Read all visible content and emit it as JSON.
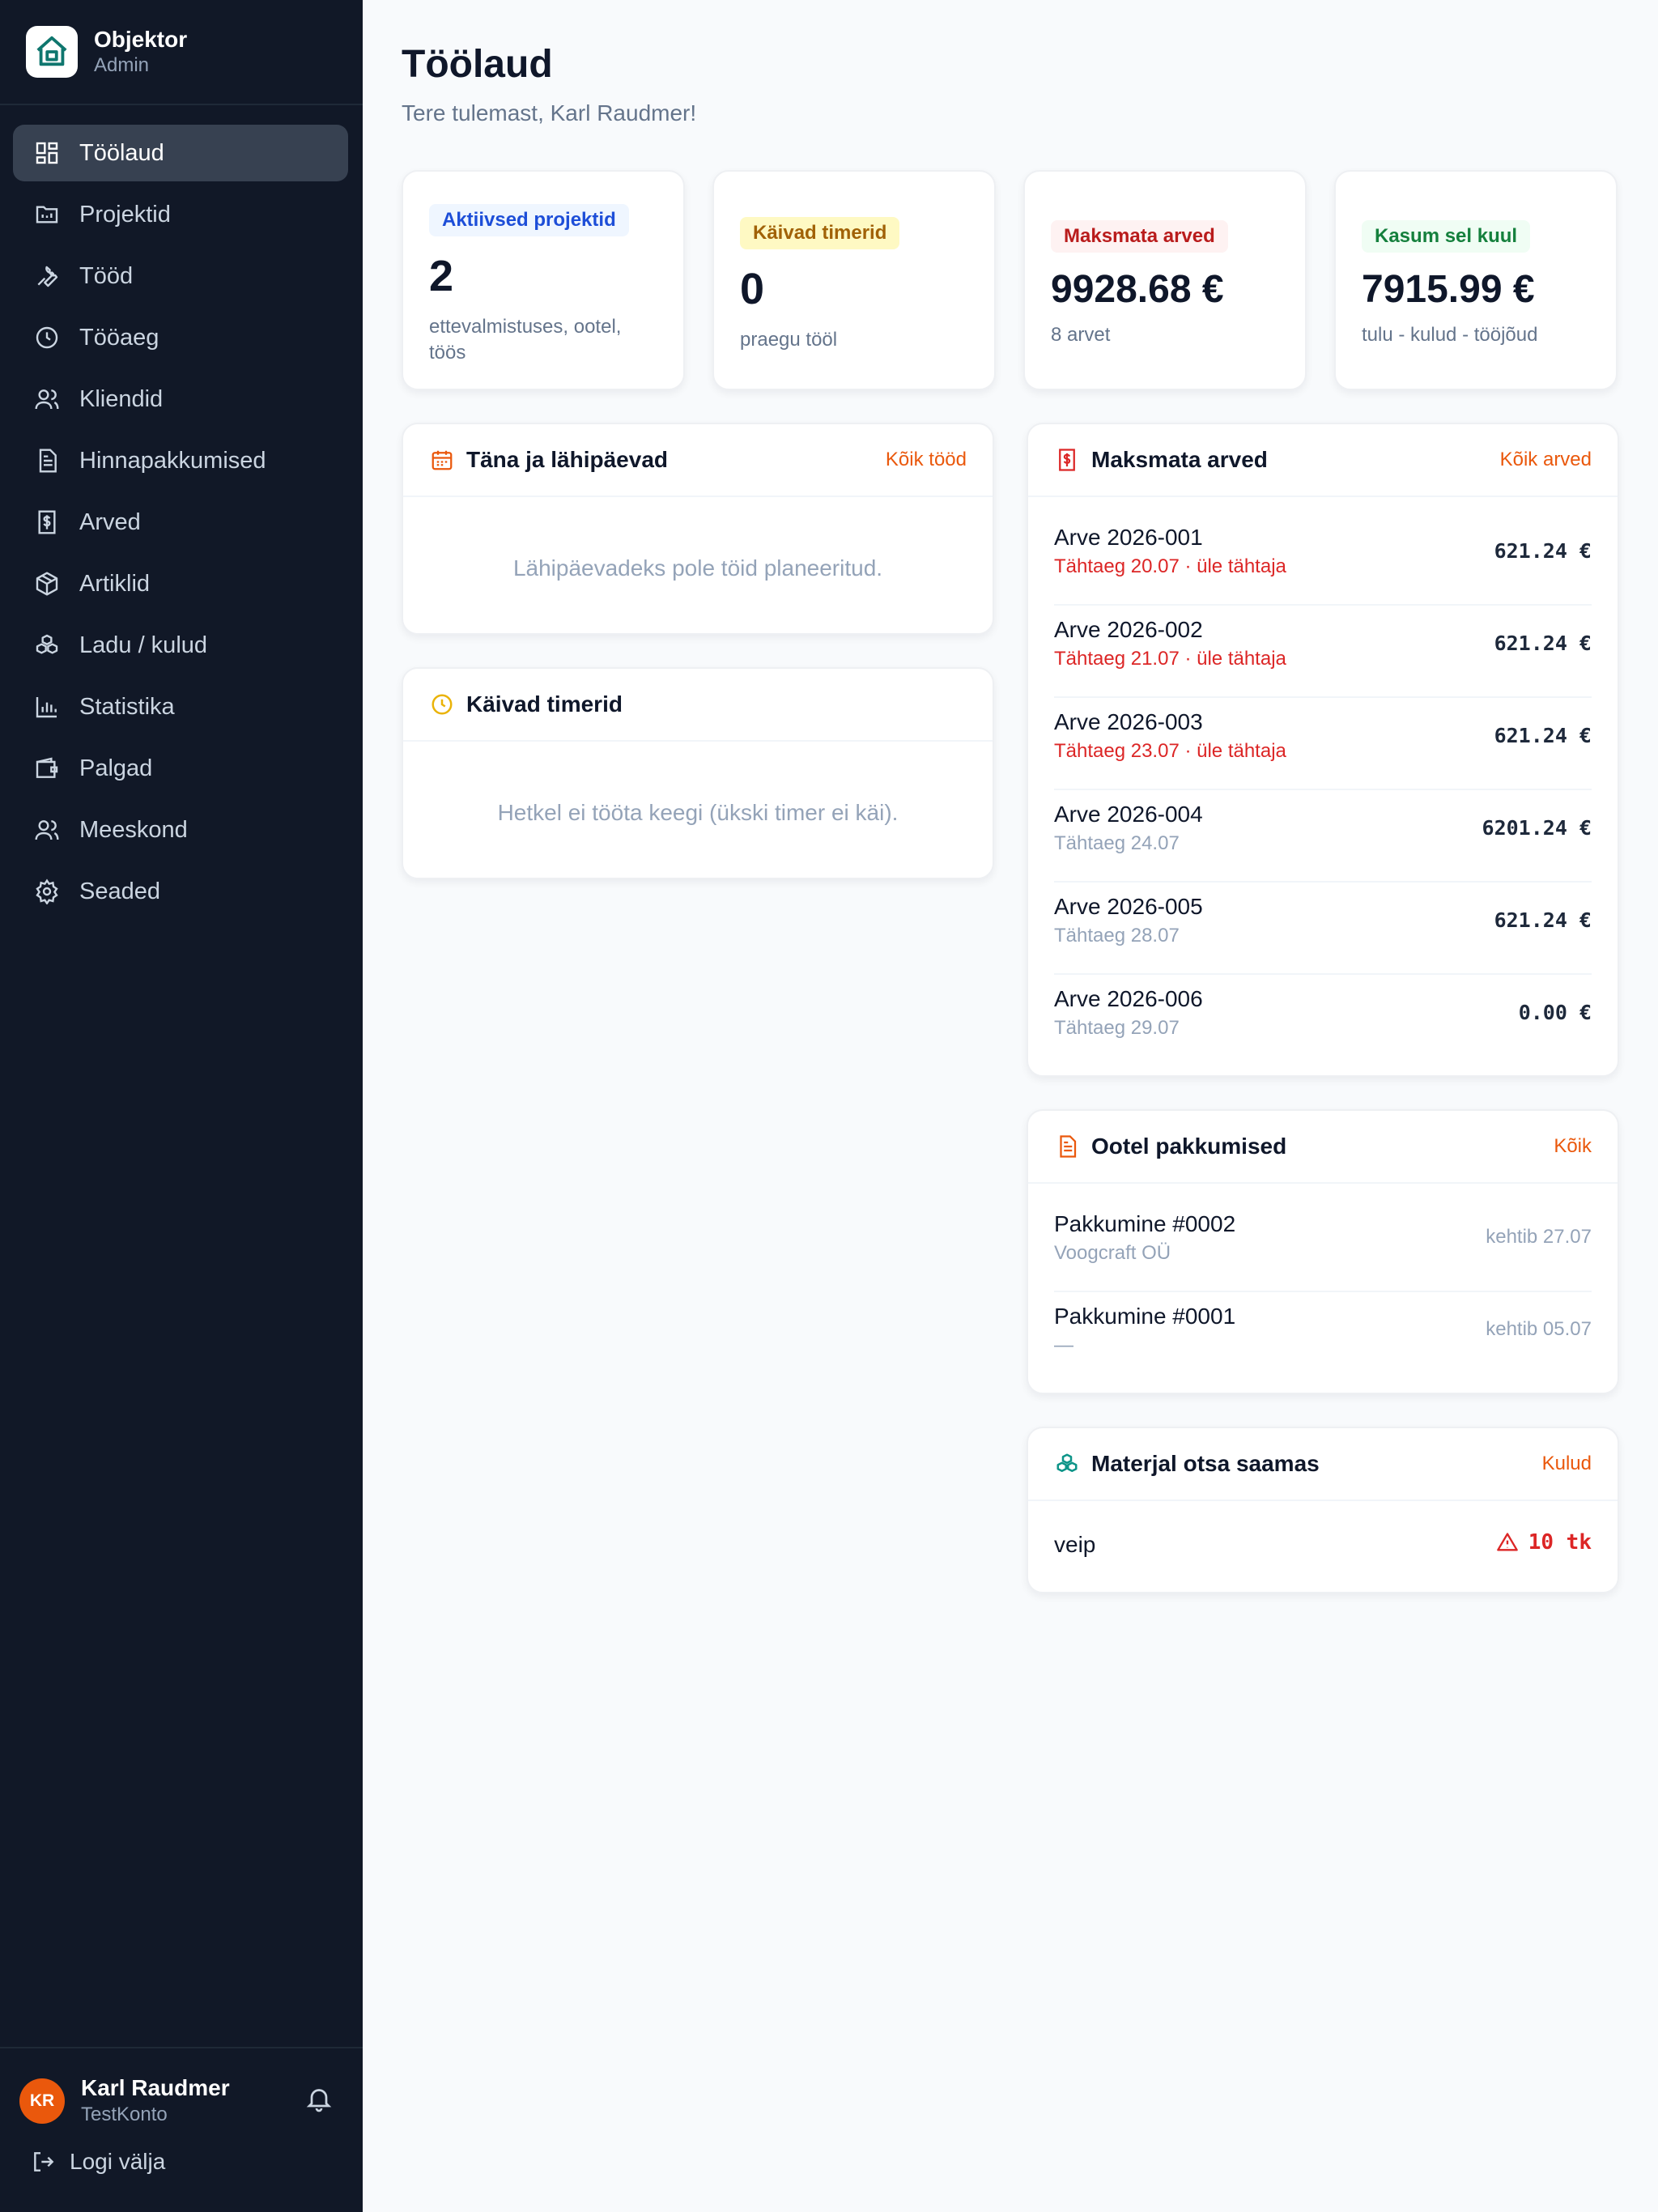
{
  "app": {
    "name": "Objektor",
    "role": "Admin"
  },
  "nav": {
    "items": [
      {
        "label": "Töölaud",
        "icon": "dashboard-icon"
      },
      {
        "label": "Projektid",
        "icon": "folder-icon"
      },
      {
        "label": "Tööd",
        "icon": "wrench-icon"
      },
      {
        "label": "Tööaeg",
        "icon": "clock-icon"
      },
      {
        "label": "Kliendid",
        "icon": "users-icon"
      },
      {
        "label": "Hinnapakkumised",
        "icon": "document-icon"
      },
      {
        "label": "Arved",
        "icon": "invoice-icon"
      },
      {
        "label": "Artiklid",
        "icon": "box-icon"
      },
      {
        "label": "Ladu / kulud",
        "icon": "boxes-icon"
      },
      {
        "label": "Statistika",
        "icon": "bar-chart-icon"
      },
      {
        "label": "Palgad",
        "icon": "wallet-icon"
      },
      {
        "label": "Meeskond",
        "icon": "team-icon"
      },
      {
        "label": "Seaded",
        "icon": "gear-icon"
      }
    ],
    "active_index": 0
  },
  "user": {
    "initials": "KR",
    "name": "Karl Raudmer",
    "account": "TestKonto",
    "logout_label": "Logi välja"
  },
  "page": {
    "title": "Töölaud",
    "subtitle": "Tere tulemast, Karl Raudmer!"
  },
  "stats": [
    {
      "badge": "Aktiivsed projektid",
      "value": "2",
      "sub": "ettevalmistuses, ootel, töös"
    },
    {
      "badge": "Käivad timerid",
      "value": "0",
      "sub": "praegu tööl"
    },
    {
      "badge": "Maksmata arved",
      "value": "9928.68 €",
      "sub": "8 arvet"
    },
    {
      "badge": "Kasum sel kuul",
      "value": "7915.99 €",
      "sub": "tulu - kulud - tööjõud"
    }
  ],
  "upcoming": {
    "title": "Täna ja lähipäevad",
    "link": "Kõik tööd",
    "empty": "Lähipäevadeks pole töid planeeritud."
  },
  "timers": {
    "title": "Käivad timerid",
    "empty": "Hetkel ei tööta keegi (ükski timer ei käi)."
  },
  "unpaid": {
    "title": "Maksmata arved",
    "link": "Kõik arved",
    "rows": [
      {
        "title": "Arve 2026-001",
        "sub": "Tähtaeg 20.07 · üle tähtaja",
        "overdue": true,
        "amount": "621.24 €"
      },
      {
        "title": "Arve 2026-002",
        "sub": "Tähtaeg 21.07 · üle tähtaja",
        "overdue": true,
        "amount": "621.24 €"
      },
      {
        "title": "Arve 2026-003",
        "sub": "Tähtaeg 23.07 · üle tähtaja",
        "overdue": true,
        "amount": "621.24 €"
      },
      {
        "title": "Arve 2026-004",
        "sub": "Tähtaeg 24.07",
        "overdue": false,
        "amount": "6201.24 €"
      },
      {
        "title": "Arve 2026-005",
        "sub": "Tähtaeg 28.07",
        "overdue": false,
        "amount": "621.24 €"
      },
      {
        "title": "Arve 2026-006",
        "sub": "Tähtaeg 29.07",
        "overdue": false,
        "amount": "0.00 €"
      }
    ]
  },
  "offers": {
    "title": "Ootel pakkumised",
    "link": "Kõik",
    "rows": [
      {
        "title": "Pakkumine #0002",
        "sub": "Voogcraft OÜ",
        "valid": "kehtib 27.07"
      },
      {
        "title": "Pakkumine #0001",
        "sub": "—",
        "valid": "kehtib 05.07"
      }
    ]
  },
  "materials": {
    "title": "Materjal otsa saamas",
    "link": "Kulud",
    "rows": [
      {
        "name": "veip",
        "qty": "10 tk",
        "icon": "warning-icon"
      }
    ]
  },
  "colors": {
    "accent": "#ea580c",
    "sidebar": "#111827",
    "danger": "#dc2626"
  }
}
